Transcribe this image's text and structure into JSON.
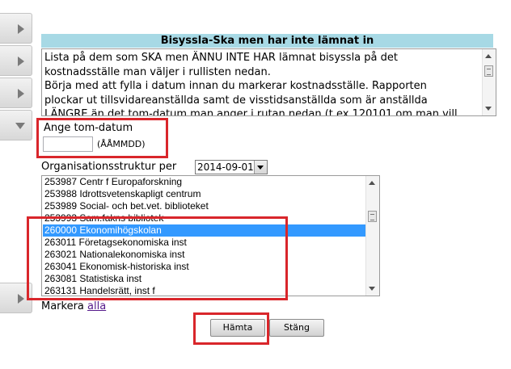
{
  "header": {
    "title": "Bisyssla-Ska men har inte lämnat in"
  },
  "description": "Lista på dem som SKA men ÄNNU INTE HAR lämnat bisyssla på det\nkostnadsställe man väljer i rullisten nedan.\nBörja med att fylla i datum innan du markerar kostnadsställe. Rapporten\nplockar ut tillsvidareanställda samt de visstidsanställda som är anställda\nLÄNGRE än det tom-datum man anger i rutan nedan (t ex 120101 om man vill",
  "tom": {
    "label": "Ange tom-datum",
    "value": "",
    "hint": "(ÅÅMMDD)"
  },
  "org": {
    "label": "Organisationsstruktur per",
    "selected": "2014-09-01",
    "options": [
      "253987 Centr f Europaforskning",
      "253988 Idrottsvetenskapligt centrum",
      "253989 Social- och bet.vet. biblioteket",
      "253993 Sam.fakns bibliotek",
      "260000 Ekonomihögskolan",
      "263011 Företagsekonomiska inst",
      "263021 Nationalekonomiska inst",
      "263041 Ekonomisk-historiska inst",
      "263081 Statistiska inst",
      "263131 Handelsrätt, inst f"
    ],
    "selected_index": 4
  },
  "markera": {
    "label": "Markera",
    "link": "alla"
  },
  "buttons": {
    "fetch": "Hämta",
    "close": "Stäng"
  },
  "icons": {
    "sidebar": [
      "expand-arrow-icon",
      "expand-arrow-icon",
      "expand-arrow-icon",
      "collapse-arrow-icon",
      "expand-arrow-icon"
    ]
  },
  "colors": {
    "header_bg": "#a7d9e5",
    "highlight": "#d9262b",
    "selected_option": "#3399ff"
  }
}
